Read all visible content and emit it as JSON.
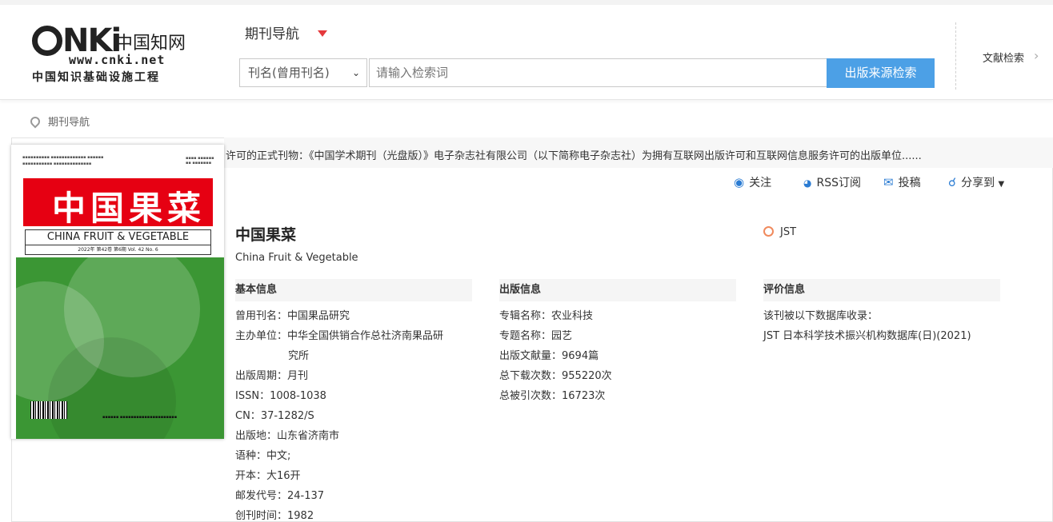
{
  "header": {
    "logo": {
      "brand": "cnki",
      "cn_name": "中国知网",
      "url": "www.cnki.net",
      "subtitle": "中国知识基础设施工程"
    },
    "nav_title": "期刊导航",
    "search": {
      "field_select": "刊名(曾用刊名)",
      "placeholder": "请输入检索词",
      "button": "出版来源检索"
    },
    "literature_search": "文献检索"
  },
  "breadcrumb": "期刊导航",
  "notice": "许可的正式刊物：《中国学术期刊（光盘版）》电子杂志社有限公司（以下简称电子杂志社）为拥有互联网出版许可和互联网信息服务许可的出版单位......",
  "actions": {
    "follow": "关注",
    "rss": "RSS订阅",
    "submit": "投稿",
    "share": "分享到"
  },
  "cover": {
    "title_cn": "中国果菜",
    "title_en": "CHINA FRUIT & VEGETABLE",
    "issue": "2022年 第42卷 第6期    Vol. 42  No. 6"
  },
  "journal": {
    "title": "中国果菜",
    "subtitle": "China Fruit & Vegetable",
    "tag": "JST"
  },
  "sections": {
    "basic": "基本信息",
    "publish": "出版信息",
    "evaluation": "评价信息"
  },
  "basic_info": [
    {
      "k": "曾用刊名：",
      "v": "中国果品研究"
    },
    {
      "k": "主办单位：",
      "v": "中华全国供销合作总社济南果品研"
    },
    {
      "k": "",
      "v": "究所"
    },
    {
      "k": "出版周期：",
      "v": "月刊"
    },
    {
      "k": "ISSN：",
      "v": "1008-1038"
    },
    {
      "k": "CN：",
      "v": "37-1282/S"
    },
    {
      "k": "出版地：",
      "v": "山东省济南市"
    },
    {
      "k": "语种：",
      "v": "中文;"
    },
    {
      "k": "开本：",
      "v": "大16开"
    },
    {
      "k": "邮发代号：",
      "v": "24-137"
    },
    {
      "k": "创刊时间：",
      "v": "1982"
    }
  ],
  "publish_info": [
    {
      "k": "专辑名称：",
      "v": "农业科技"
    },
    {
      "k": "专题名称：",
      "v": "园艺"
    },
    {
      "k": "出版文献量：",
      "v": "9694篇"
    },
    {
      "k": "总下载次数：",
      "v": "955220次"
    },
    {
      "k": "总被引次数：",
      "v": "16723次"
    }
  ],
  "evaluation_info": [
    "该刊被以下数据库收录：",
    "JST 日本科学技术振兴机构数据库(日)(2021)"
  ]
}
